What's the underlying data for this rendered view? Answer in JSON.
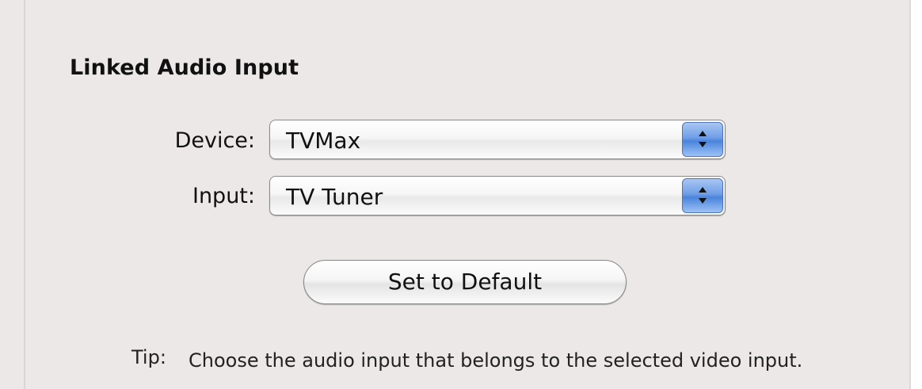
{
  "section": {
    "title": "Linked Audio Input"
  },
  "device": {
    "label": "Device:",
    "value": "TVMax"
  },
  "input": {
    "label": "Input:",
    "value": "TV Tuner"
  },
  "button": {
    "label": "Set to Default"
  },
  "tip": {
    "label": "Tip:",
    "text": "Choose the audio input that belongs to the selected video input."
  },
  "icons": {
    "popup_stepper": "up-down-arrows-icon"
  }
}
